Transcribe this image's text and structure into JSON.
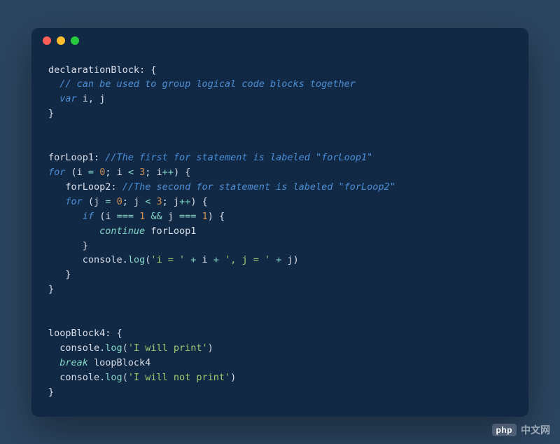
{
  "code": {
    "l1": {
      "label": "declarationBlock",
      "colon": ": ",
      "brace": "{"
    },
    "l2": {
      "indent": "  ",
      "comment": "// can be used to group logical code blocks together"
    },
    "l3": {
      "indent": "  ",
      "kw": "var",
      "vars": " i, j"
    },
    "l4": {
      "brace": "}"
    },
    "l7": {
      "label": "forLoop1",
      "colon": ": ",
      "comment": "//The first for statement is labeled \"forLoop1\""
    },
    "l8": {
      "kw": "for",
      "sp": " ",
      "p1": "(i ",
      "op1": "=",
      "sp2": " ",
      "num1": "0",
      "p2": "; i ",
      "op2": "<",
      "sp3": " ",
      "num2": "3",
      "p3": "; i",
      "op3": "++",
      "p4": ") {"
    },
    "l9": {
      "indent": "   ",
      "label": "forLoop2",
      "colon": ": ",
      "comment": "//The second for statement is labeled \"forLoop2\""
    },
    "l10": {
      "indent": "   ",
      "kw": "for",
      "sp": " ",
      "p1": "(j ",
      "op1": "=",
      "sp2": " ",
      "num1": "0",
      "p2": "; j ",
      "op2": "<",
      "sp3": " ",
      "num2": "3",
      "p3": "; j",
      "op3": "++",
      "p4": ") {"
    },
    "l11": {
      "indent": "      ",
      "kw": "if",
      "sp": " ",
      "p1": "(i ",
      "op1": "===",
      "sp2": " ",
      "num1": "1",
      "sp3": " ",
      "op2": "&&",
      "sp4": " j ",
      "op3": "===",
      "sp5": " ",
      "num2": "1",
      "p2": ") {"
    },
    "l12": {
      "indent": "         ",
      "kw": "continue",
      "target": " forLoop1"
    },
    "l13": {
      "indent": "      ",
      "brace": "}"
    },
    "l14": {
      "indent": "      ",
      "obj": "console.",
      "fn": "log",
      "p1": "(",
      "s1": "'i = '",
      "sp1": " ",
      "op1": "+",
      "sp2": " i ",
      "op2": "+",
      "sp3": " ",
      "s2": "', j = '",
      "sp4": " ",
      "op3": "+",
      "sp5": " j)"
    },
    "l15": {
      "indent": "   ",
      "brace": "}"
    },
    "l16": {
      "brace": "}"
    },
    "l19": {
      "label": "loopBlock4",
      "colon": ": ",
      "brace": "{"
    },
    "l20": {
      "indent": "  ",
      "obj": "console.",
      "fn": "log",
      "p1": "(",
      "s1": "'I will print'",
      "p2": ")"
    },
    "l21": {
      "indent": "  ",
      "kw": "break",
      "target": " loopBlock4"
    },
    "l22": {
      "indent": "  ",
      "obj": "console.",
      "fn": "log",
      "p1": "(",
      "s1": "'I will not print'",
      "p2": ")"
    },
    "l23": {
      "brace": "}"
    }
  },
  "watermark": {
    "badge": "php",
    "text": "中文网"
  }
}
